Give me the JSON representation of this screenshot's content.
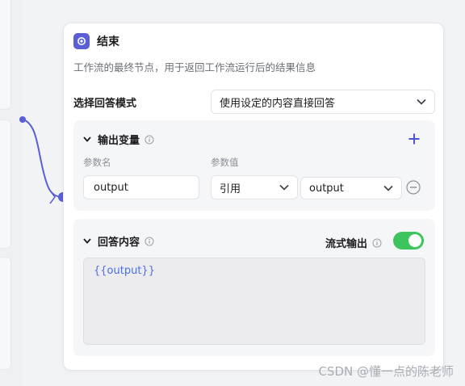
{
  "node": {
    "title": "结束",
    "description": "工作流的最终节点，用于返回工作流运行后的结果信息"
  },
  "answer_mode": {
    "label": "选择回答模式",
    "selected": "使用设定的内容直接回答"
  },
  "output_vars": {
    "title": "输出变量",
    "col_name": "参数名",
    "col_value": "参数值",
    "rows": [
      {
        "name": "output",
        "ref_type": "引用",
        "ref_value": "output"
      }
    ]
  },
  "answer_content": {
    "title": "回答内容",
    "stream_label": "流式输出",
    "stream_on": true,
    "template": "{{output}}"
  },
  "watermark": "CSDN @懂一点的陈老师",
  "colors": {
    "accent": "#5a5fd6",
    "toggle_on": "#3ec45c",
    "template_text": "#4c6ee8"
  }
}
